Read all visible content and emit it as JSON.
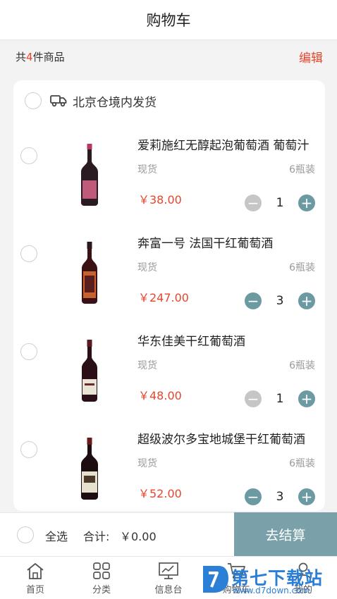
{
  "header": {
    "title": "购物车"
  },
  "summary": {
    "prefix": "共",
    "count": "4",
    "suffix": "件商品",
    "edit_label": "编辑"
  },
  "warehouse": {
    "label": "北京仓境内发货",
    "icon": "truck-icon"
  },
  "items": [
    {
      "name": "爱莉施红无醇起泡葡萄酒 葡萄汁",
      "stock": "现货",
      "pack": "6瓶装",
      "price": "￥38.00",
      "qty": "1",
      "minus_enabled": false,
      "label_color": "#c05a7a"
    },
    {
      "name": "奔富一号 法国干红葡萄酒",
      "stock": "现货",
      "pack": "6瓶装",
      "price": "￥247.00",
      "qty": "3",
      "minus_enabled": true,
      "label_color": "#c8622f"
    },
    {
      "name": "华东佳美干红葡萄酒",
      "stock": "现货",
      "pack": "6瓶装",
      "price": "￥48.00",
      "qty": "1",
      "minus_enabled": false,
      "label_color": "#e9e4d6"
    },
    {
      "name": "超级波尔多宝地城堡干红葡萄酒",
      "stock": "现货",
      "pack": "6瓶装",
      "price": "￥52.00",
      "qty": "3",
      "minus_enabled": true,
      "label_color": "#e6e0cf"
    }
  ],
  "footer": {
    "select_all": "全选",
    "total_label": "合计:",
    "total": "￥0.00",
    "checkout": "去结算"
  },
  "tabs": [
    {
      "label": "首页",
      "icon": "home-icon"
    },
    {
      "label": "分类",
      "icon": "category-icon"
    },
    {
      "label": "信息台",
      "icon": "info-icon"
    },
    {
      "label": "购物车",
      "icon": "cart-icon"
    },
    {
      "label": "我的",
      "icon": "profile-icon"
    }
  ],
  "watermark": {
    "text": "第七下载站",
    "url": "www.d7down.com"
  },
  "colors": {
    "accent": "#e8452e",
    "stepper": "#6b9aa3",
    "checkout": "#7aa0a9",
    "disabled": "#c6c6c6"
  }
}
